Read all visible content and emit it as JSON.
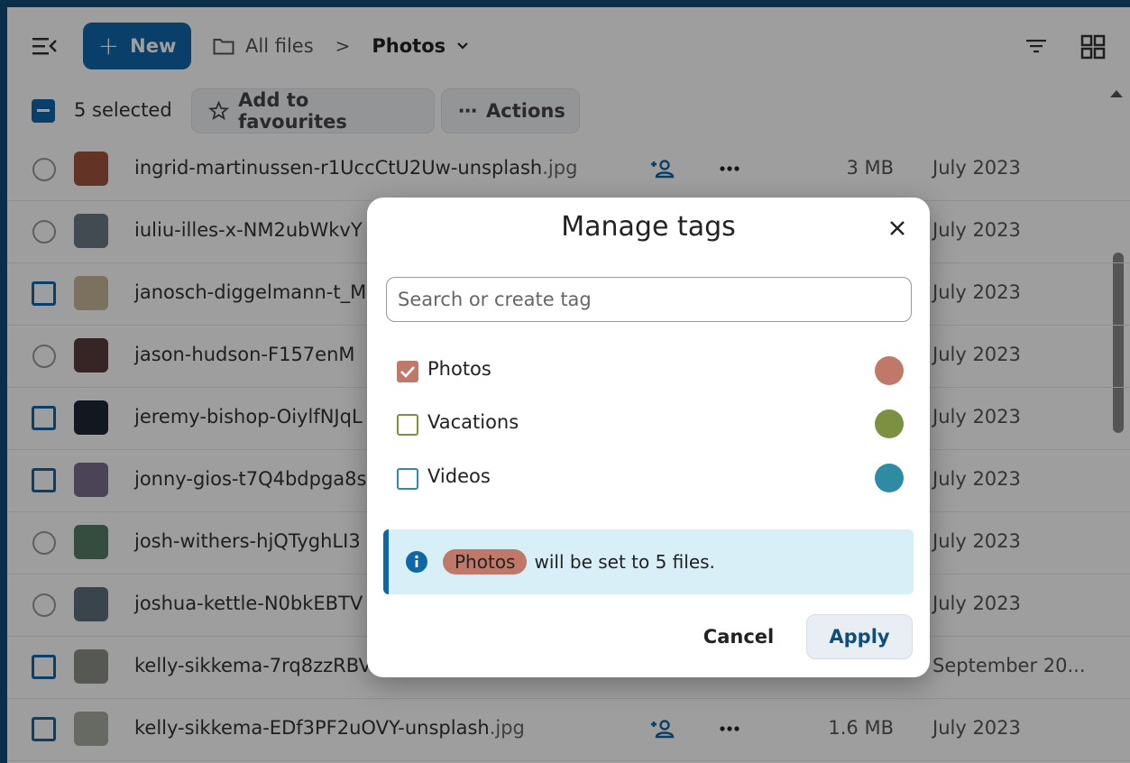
{
  "header": {
    "new_label": "New",
    "breadcrumb_root": "All files",
    "breadcrumb_sep": ">",
    "breadcrumb_current": "Photos"
  },
  "selection": {
    "count_label": "5 selected",
    "favourites_label": "Add to favourites",
    "actions_label": "Actions"
  },
  "files": [
    {
      "name": "ingrid-martinussen-r1UccCtU2Uw-unsplash",
      "ext": ".jpg",
      "size": "3 MB",
      "date": "July 2023",
      "selected": false,
      "thumb": "#a0533e"
    },
    {
      "name": "iuliu-illes-x-NM2ubWkvY",
      "ext": "",
      "size": "",
      "date": "July 2023",
      "selected": false,
      "thumb": "#6b7a83"
    },
    {
      "name": "janosch-diggelmann-t_M",
      "ext": "",
      "size": "",
      "date": "July 2023",
      "selected": true,
      "thumb": "#c9b79a"
    },
    {
      "name": "jason-hudson-F157enM",
      "ext": "",
      "size": "",
      "date": "July 2023",
      "selected": false,
      "thumb": "#5a3b3a"
    },
    {
      "name": "jeremy-bishop-OiylfNJqL",
      "ext": "",
      "size": "",
      "date": "July 2023",
      "selected": true,
      "thumb": "#1d2733"
    },
    {
      "name": "jonny-gios-t7Q4bdpga8s",
      "ext": "",
      "size": "",
      "date": "July 2023",
      "selected": true,
      "thumb": "#7a6d8c"
    },
    {
      "name": "josh-withers-hjQTyghLI3",
      "ext": "",
      "size": "",
      "date": "July 2023",
      "selected": false,
      "thumb": "#567d65"
    },
    {
      "name": "joshua-kettle-N0bkEBTV",
      "ext": "",
      "size": "",
      "date": "July 2023",
      "selected": false,
      "thumb": "#5d6e7c"
    },
    {
      "name": "kelly-sikkema-7rq8zzRBV",
      "ext": "",
      "size": "",
      "date": "September 20...",
      "selected": true,
      "thumb": "#8a8f86"
    },
    {
      "name": "kelly-sikkema-EDf3PF2uOVY-unsplash",
      "ext": ".jpg",
      "size": "1.6 MB",
      "date": "July 2023",
      "selected": true,
      "thumb": "#a7ab9f"
    }
  ],
  "modal": {
    "title": "Manage tags",
    "search_placeholder": "Search or create tag",
    "tags": [
      {
        "name": "Photos",
        "checked": true,
        "color": "#c07868"
      },
      {
        "name": "Vacations",
        "checked": false,
        "color": "#7b9040"
      },
      {
        "name": "Videos",
        "checked": false,
        "color": "#2f8aa3"
      }
    ],
    "info_chip": "Photos",
    "info_text": "will be set to 5 files.",
    "cancel_label": "Cancel",
    "apply_label": "Apply"
  },
  "colors": {
    "primary": "#0f67a8",
    "info_bg": "#d8eff8"
  }
}
